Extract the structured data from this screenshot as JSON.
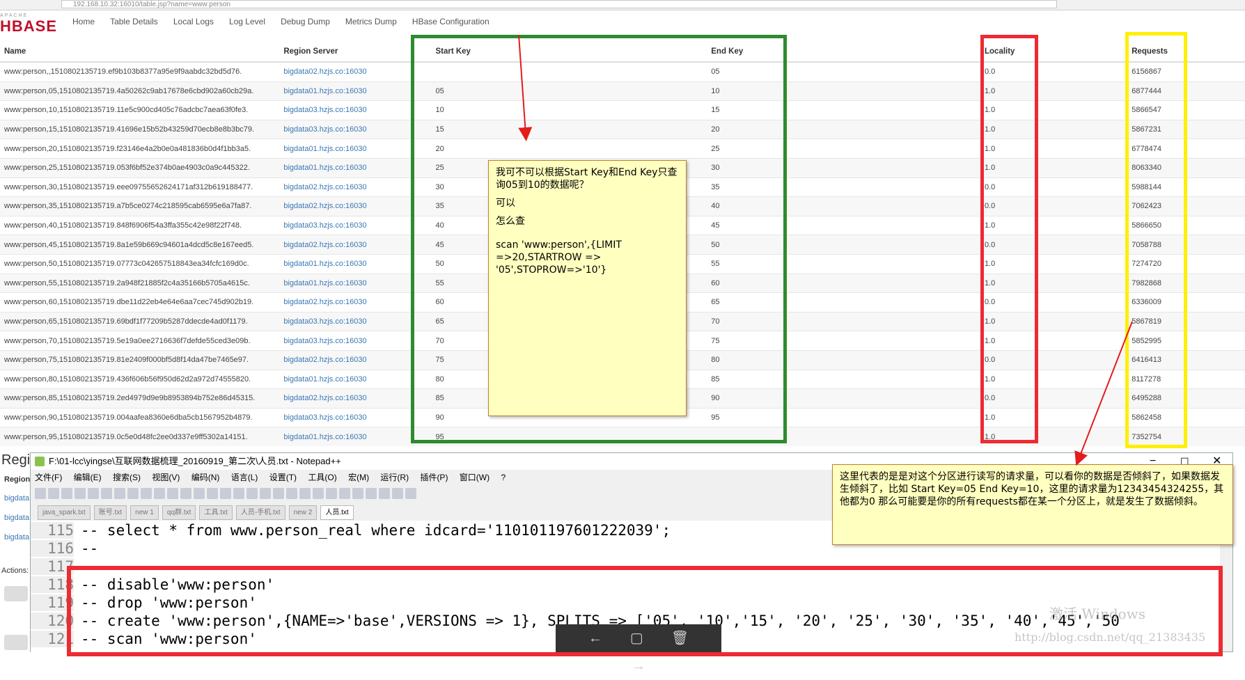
{
  "browser": {
    "url": "192.168.10.32:16010/table.jsp?name=www:person"
  },
  "logo": {
    "line1": "APACHE",
    "line2": "HBASE"
  },
  "nav": [
    "Home",
    "Table Details",
    "Local Logs",
    "Log Level",
    "Debug Dump",
    "Metrics Dump",
    "HBase Configuration"
  ],
  "table": {
    "headers": [
      "Name",
      "Region Server",
      "Start Key",
      "End Key",
      "Locality",
      "Requests"
    ],
    "rows": [
      [
        "www:person,,1510802135719.ef9b103b8377a95e9f9aabdc32bd5d76.",
        "bigdata02.hzjs.co:16030",
        "",
        "05",
        "0.0",
        "6156867"
      ],
      [
        "www:person,05,1510802135719.4a50262c9ab17678e6cbd902a60cb29a.",
        "bigdata01.hzjs.co:16030",
        "05",
        "10",
        "1.0",
        "6877444"
      ],
      [
        "www:person,10,1510802135719.11e5c900cd405c76adcbc7aea63f0fe3.",
        "bigdata03.hzjs.co:16030",
        "10",
        "15",
        "1.0",
        "5866547"
      ],
      [
        "www:person,15,1510802135719.41696e15b52b43259d70ecb8e8b3bc79.",
        "bigdata03.hzjs.co:16030",
        "15",
        "20",
        "1.0",
        "5867231"
      ],
      [
        "www:person,20,1510802135719.f23146e4a2b0e0a481836b0d4f1bb3a5.",
        "bigdata01.hzjs.co:16030",
        "20",
        "25",
        "1.0",
        "6778474"
      ],
      [
        "www:person,25,1510802135719.053f6bf52e374b0ae4903c0a9c445322.",
        "bigdata01.hzjs.co:16030",
        "25",
        "30",
        "1.0",
        "8063340"
      ],
      [
        "www:person,30,1510802135719.eee09755652624171af312b619188477.",
        "bigdata02.hzjs.co:16030",
        "30",
        "35",
        "0.0",
        "5988144"
      ],
      [
        "www:person,35,1510802135719.a7b5ce0274c218595cab6595e6a7fa87.",
        "bigdata02.hzjs.co:16030",
        "35",
        "40",
        "0.0",
        "7062423"
      ],
      [
        "www:person,40,1510802135719.848f6906f54a3ffa355c42e98f22f748.",
        "bigdata03.hzjs.co:16030",
        "40",
        "45",
        "1.0",
        "5866650"
      ],
      [
        "www:person,45,1510802135719.8a1e59b669c94601a4dcd5c8e167eed5.",
        "bigdata02.hzjs.co:16030",
        "45",
        "50",
        "0.0",
        "7058788"
      ],
      [
        "www:person,50,1510802135719.07773c042657518843ea34fcfc169d0c.",
        "bigdata01.hzjs.co:16030",
        "50",
        "55",
        "1.0",
        "7274720"
      ],
      [
        "www:person,55,1510802135719.2a948f21885f2c4a35166b5705a4615c.",
        "bigdata01.hzjs.co:16030",
        "55",
        "60",
        "1.0",
        "7982868"
      ],
      [
        "www:person,60,1510802135719.dbe11d22eb4e64e6aa7cec745d902b19.",
        "bigdata02.hzjs.co:16030",
        "60",
        "65",
        "0.0",
        "6336009"
      ],
      [
        "www:person,65,1510802135719.69bdf1f77209b5287ddecde4ad0f1179.",
        "bigdata03.hzjs.co:16030",
        "65",
        "70",
        "1.0",
        "5867819"
      ],
      [
        "www:person,70,1510802135719.5e19a0ee2716636f7defde55ced3e09b.",
        "bigdata03.hzjs.co:16030",
        "70",
        "75",
        "1.0",
        "5852995"
      ],
      [
        "www:person,75,1510802135719.81e2409f000bf5d8f14da47be7465e97.",
        "bigdata02.hzjs.co:16030",
        "75",
        "80",
        "0.0",
        "6416413"
      ],
      [
        "www:person,80,1510802135719.436f606b56f950d62d2a972d74555820.",
        "bigdata01.hzjs.co:16030",
        "80",
        "85",
        "1.0",
        "8117278"
      ],
      [
        "www:person,85,1510802135719.2ed4979d9e9b8953894b752e86d45315.",
        "bigdata02.hzjs.co:16030",
        "85",
        "90",
        "0.0",
        "6495288"
      ],
      [
        "www:person,90,1510802135719.004aafea8360e6dba5cb1567952b4879.",
        "bigdata03.hzjs.co:16030",
        "90",
        "95",
        "1.0",
        "5862458"
      ],
      [
        "www:person,95,1510802135719.0c5e0d48fc2ee0d337e9ff5302a14151.",
        "bigdata01.hzjs.co:16030",
        "95",
        "",
        "1.0",
        "7352754"
      ]
    ]
  },
  "note1": {
    "q": "我可不可以根据Start Key和End Key只查询05到10的数据呢？",
    "a1": "可以",
    "a2": "怎么查",
    "cmd": "scan 'www:person',{LIMIT =>20,STARTROW => '05',STOPROW=>'10'}"
  },
  "note2": {
    "text": "这里代表的是是对这个分区进行读写的请求量，可以看你的数据是否倾斜了，如果数据发生倾斜了，比如 Start Key=05  End Key=10，这里的请求量为12343454324255，其他都为0 那么可能要是你的所有requests都在某一个分区上，就是发生了数据倾斜。"
  },
  "left_strip": {
    "heading": "Regi",
    "sub": "Region",
    "links": [
      "bigdata",
      "bigdata",
      "bigdata"
    ],
    "actions": "Actions:"
  },
  "notepad": {
    "title": "F:\\01-lcc\\yingse\\互联网数据梳理_20160919_第二次\\人员.txt - Notepad++",
    "menu": [
      "文件(F)",
      "编辑(E)",
      "搜索(S)",
      "视图(V)",
      "编码(N)",
      "语言(L)",
      "设置(T)",
      "工具(O)",
      "宏(M)",
      "运行(R)",
      "插件(P)",
      "窗口(W)",
      "?"
    ],
    "tabs": [
      "java_spark.txt",
      "账号.txt",
      "new 1",
      "qq群.txt",
      "工具.txt",
      "人员-手机.txt",
      "new 2",
      "人员.txt"
    ],
    "active_tab": "人员.txt",
    "lines": [
      {
        "n": "115",
        "t": "-- select * from www.person_real where idcard='110101197601222039';"
      },
      {
        "n": "116",
        "t": "--"
      },
      {
        "n": "117",
        "t": "--"
      },
      {
        "n": "118",
        "t": "-- disable'www:person'"
      },
      {
        "n": "119",
        "t": "-- drop 'www:person'"
      },
      {
        "n": "120",
        "t": "-- create 'www:person',{NAME=>'base',VERSIONS => 1}, SPLITS => ['05', '10','15', '20', '25', '30', '35', '40','45','50"
      },
      {
        "n": "121",
        "t": "-- scan 'www:person'"
      }
    ]
  },
  "viewer": {
    "prev": "←",
    "comment": "▢",
    "delete": "🗑",
    "next": "→"
  },
  "watermark": {
    "windows": "激活 Windows",
    "blog": "http://blog.csdn.net/qq_21383435"
  }
}
